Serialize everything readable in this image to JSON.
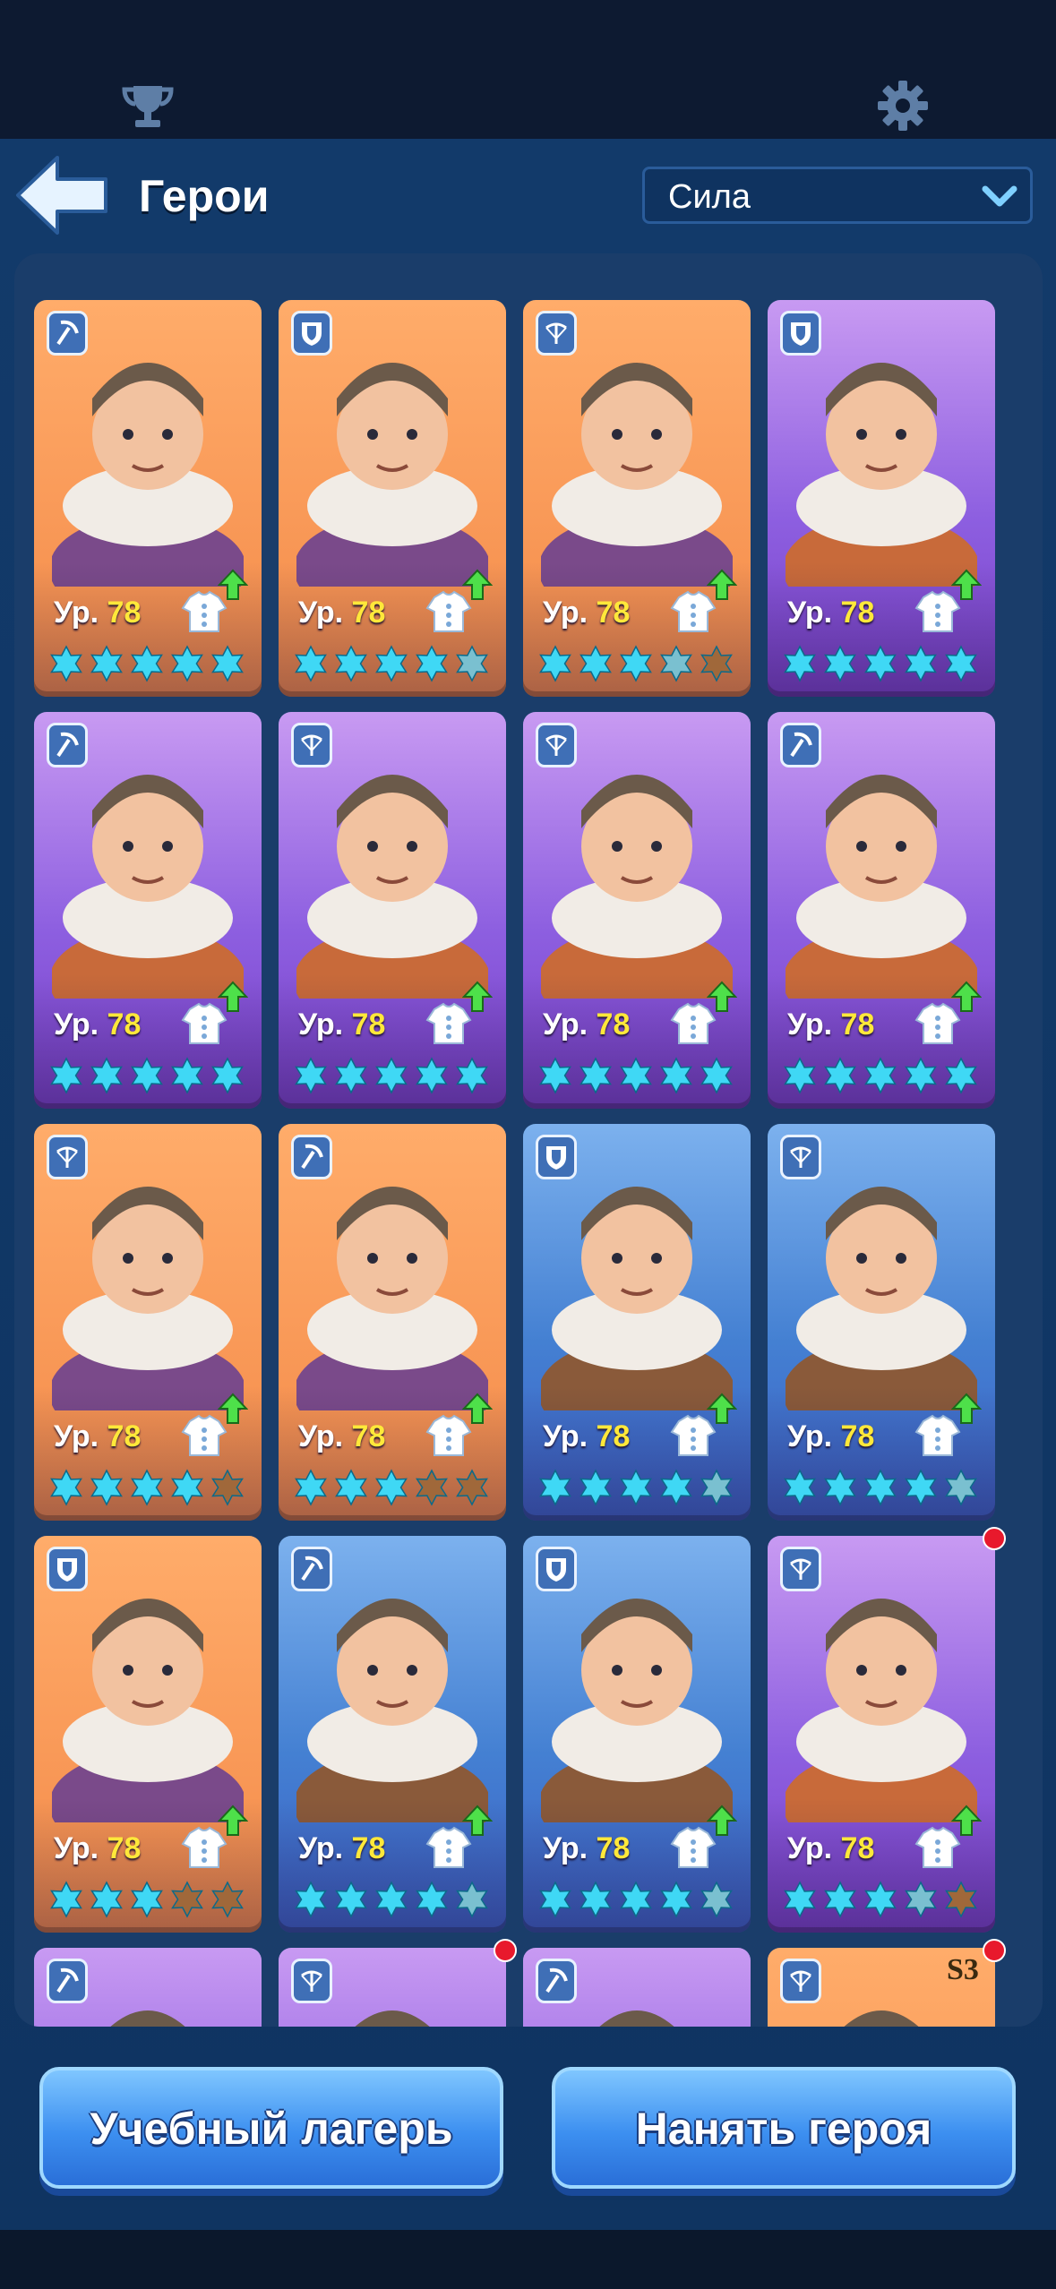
{
  "header": {
    "title": "Герои",
    "sort_value": "Сила",
    "trophy_icon": "trophy-icon",
    "settings_icon": "gear-icon"
  },
  "buttons": {
    "training_camp": "Учебный лагерь",
    "hire_hero": "Нанять героя"
  },
  "level_prefix": "Ур.",
  "colors": {
    "accent_blue": "#3c8ff0",
    "level_yellow": "#ffe83a",
    "star_cyan": "#3fd8f5",
    "notification_red": "#e8192c"
  },
  "heroes": [
    {
      "role": "pickaxe",
      "bg": "orange",
      "level": "78",
      "stars": 5,
      "notify": false
    },
    {
      "role": "shield",
      "bg": "orange",
      "level": "78",
      "stars": 4.5,
      "notify": false
    },
    {
      "role": "crossbow",
      "bg": "orange",
      "level": "78",
      "stars": 3.5,
      "notify": false
    },
    {
      "role": "shield",
      "bg": "purple",
      "level": "78",
      "stars": 5,
      "notify": false
    },
    {
      "role": "pickaxe",
      "bg": "purple",
      "level": "78",
      "stars": 5,
      "notify": false
    },
    {
      "role": "crossbow",
      "bg": "purple",
      "level": "78",
      "stars": 5,
      "notify": false
    },
    {
      "role": "crossbow",
      "bg": "purple",
      "level": "78",
      "stars": 5,
      "notify": false
    },
    {
      "role": "pickaxe",
      "bg": "purple",
      "level": "78",
      "stars": 5,
      "notify": false
    },
    {
      "role": "crossbow",
      "bg": "orange",
      "level": "78",
      "stars": 4,
      "notify": false
    },
    {
      "role": "pickaxe",
      "bg": "orange",
      "level": "78",
      "stars": 3,
      "notify": false
    },
    {
      "role": "shield",
      "bg": "blue",
      "level": "78",
      "stars": 4.5,
      "notify": false
    },
    {
      "role": "crossbow",
      "bg": "blue",
      "level": "78",
      "stars": 4.5,
      "notify": false
    },
    {
      "role": "shield",
      "bg": "orange",
      "level": "78",
      "stars": 3,
      "notify": false
    },
    {
      "role": "pickaxe",
      "bg": "blue",
      "level": "78",
      "stars": 4.5,
      "notify": false
    },
    {
      "role": "shield",
      "bg": "blue",
      "level": "78",
      "stars": 4.5,
      "notify": false
    },
    {
      "role": "crossbow",
      "bg": "purple",
      "level": "78",
      "stars": 3.5,
      "notify": true
    },
    {
      "role": "pickaxe",
      "bg": "purple",
      "level": "",
      "stars": 0,
      "notify": false
    },
    {
      "role": "crossbow",
      "bg": "purple",
      "level": "",
      "stars": 0,
      "notify": true
    },
    {
      "role": "pickaxe",
      "bg": "purple",
      "level": "",
      "stars": 0,
      "notify": false
    },
    {
      "role": "crossbow",
      "bg": "orange",
      "level": "",
      "stars": 0,
      "notify": true,
      "badge": "S3"
    }
  ]
}
